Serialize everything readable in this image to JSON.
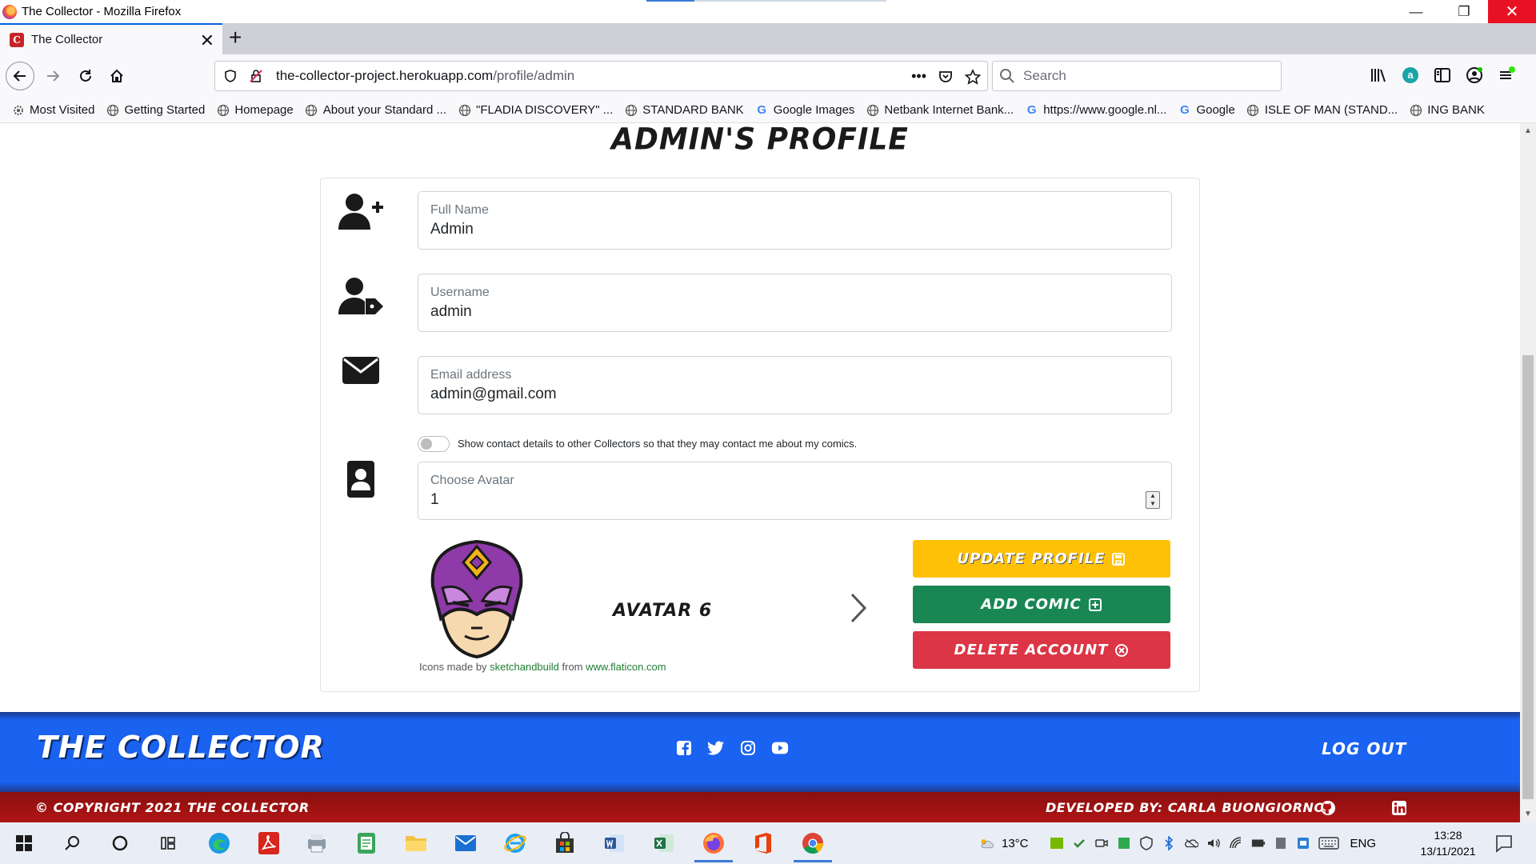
{
  "window": {
    "title": "The Collector - Mozilla Firefox",
    "minimize": "—",
    "restore": "❐",
    "close": "✕"
  },
  "tabs": [
    {
      "label": "The Collector",
      "favicon_letter": "C",
      "close": "✕"
    }
  ],
  "new_tab": "+",
  "navbar": {
    "url_host": "the-collector-project.herokuapp.com",
    "url_path": "/profile/admin",
    "url_actions": "•••",
    "search_placeholder": "Search"
  },
  "bookmarks": [
    {
      "label": "Most Visited",
      "icon": "gear-icon"
    },
    {
      "label": "Getting Started",
      "icon": "globe-icon"
    },
    {
      "label": "Homepage",
      "icon": "globe-icon"
    },
    {
      "label": "About your Standard ...",
      "icon": "globe-icon"
    },
    {
      "label": "\"FLADIA DISCOVERY\" ...",
      "icon": "globe-icon"
    },
    {
      "label": "STANDARD BANK",
      "icon": "globe-icon"
    },
    {
      "label": "Google Images",
      "icon": "google-icon"
    },
    {
      "label": "Netbank Internet Bank...",
      "icon": "globe-icon"
    },
    {
      "label": "https://www.google.nl...",
      "icon": "google-icon"
    },
    {
      "label": "Google",
      "icon": "google-icon"
    },
    {
      "label": "ISLE OF MAN (STAND...",
      "icon": "globe-icon"
    },
    {
      "label": "ING BANK",
      "icon": "globe-icon"
    }
  ],
  "page": {
    "title": "ADMIN'S PROFILE",
    "fields": {
      "full_name": {
        "label": "Full Name",
        "value": "Admin"
      },
      "username": {
        "label": "Username",
        "value": "admin"
      },
      "email": {
        "label": "Email address",
        "value": "admin@gmail.com"
      },
      "avatar": {
        "label": "Choose Avatar",
        "value": "1"
      }
    },
    "contact_toggle_text": "Show contact details to other Collectors so that they may contact me about my comics.",
    "contact_toggle_on": false,
    "avatar_name": "AVATAR 6",
    "credit": {
      "prefix": "Icons made by ",
      "author": "sketchandbuild",
      "middle": " from ",
      "site": "www.flaticon.com"
    },
    "buttons": {
      "update": "UPDATE PROFILE",
      "add": "ADD COMIC",
      "delete": "DELETE ACCOUNT"
    },
    "colors": {
      "update": "#ffc107",
      "add": "#198754",
      "delete": "#dc3545",
      "footer_blue": "#1a62f0",
      "footer_red": "#b01515"
    }
  },
  "footer": {
    "brand": "THE COLLECTOR",
    "logout": "LOG OUT",
    "copyright": "© COPYRIGHT 2021 THE COLLECTOR",
    "developer": "DEVELOPED BY: CARLA BUONGIORNO",
    "social_icons": [
      "facebook-icon",
      "twitter-icon",
      "instagram-icon",
      "youtube-icon"
    ]
  },
  "taskbar": {
    "temperature": "13°C",
    "language": "ENG",
    "time": "13:28",
    "date": "13/11/2021"
  }
}
